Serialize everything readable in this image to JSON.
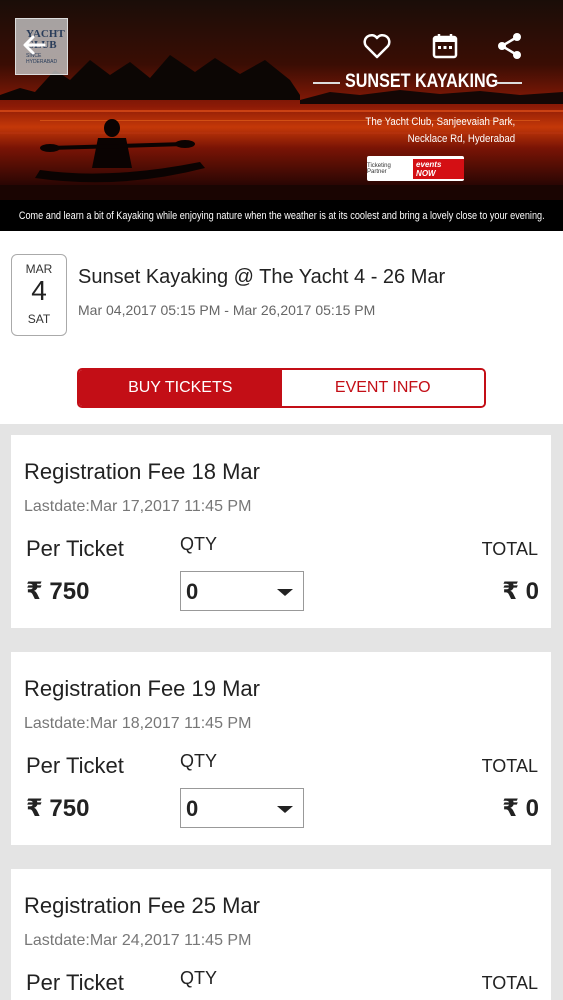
{
  "banner": {
    "logo_text": "YACHT CLUB",
    "logo_sub": "SINCE HYDERABAD",
    "event_title": "SUNSET KAYAKING",
    "venue_line1": "The Yacht Club, Sanjeevaiah Park,",
    "venue_line2": "Necklace Rd, Hyderabad",
    "partner_label": "Ticketing Partner",
    "partner_brand": "events NOW",
    "tagline": "Come and learn a bit of Kayaking while enjoying nature when the weather is at its coolest and bring a lovely close to your evening."
  },
  "event": {
    "month": "MAR",
    "day": "4",
    "weekday": "SAT",
    "name": "Sunset Kayaking @ The Yacht 4 - 26 Mar",
    "range": "Mar 04,2017 05:15 PM - Mar 26,2017 05:15 PM"
  },
  "tabs": {
    "buy": "BUY TICKETS",
    "info": "EVENT INFO"
  },
  "tickets": [
    {
      "name": "Registration Fee 18 Mar",
      "lastdate": "Lastdate:Mar 17,2017 11:45 PM",
      "per_ticket_label": "Per Ticket",
      "qty_label": "QTY",
      "total_label": "TOTAL",
      "price": "₹ 750",
      "qty": "0",
      "total": "₹ 0"
    },
    {
      "name": "Registration Fee 19 Mar",
      "lastdate": "Lastdate:Mar 18,2017 11:45 PM",
      "per_ticket_label": "Per Ticket",
      "qty_label": "QTY",
      "total_label": "TOTAL",
      "price": "₹ 750",
      "qty": "0",
      "total": "₹ 0"
    },
    {
      "name": "Registration Fee 25 Mar",
      "lastdate": "Lastdate:Mar 24,2017 11:45 PM",
      "per_ticket_label": "Per Ticket",
      "qty_label": "QTY",
      "total_label": "TOTAL"
    }
  ],
  "colors": {
    "accent": "#c30e16",
    "background": "#e4e4e4"
  }
}
